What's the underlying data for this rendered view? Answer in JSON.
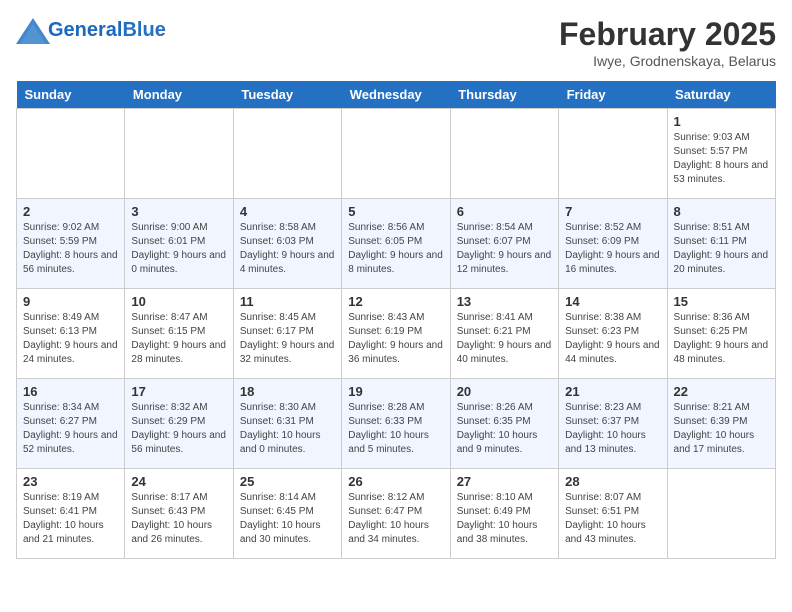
{
  "header": {
    "logo_line1": "General",
    "logo_line2": "Blue",
    "month_title": "February 2025",
    "location": "Iwye, Grodnenskaya, Belarus"
  },
  "days_of_week": [
    "Sunday",
    "Monday",
    "Tuesday",
    "Wednesday",
    "Thursday",
    "Friday",
    "Saturday"
  ],
  "weeks": [
    [
      {
        "day": "",
        "info": ""
      },
      {
        "day": "",
        "info": ""
      },
      {
        "day": "",
        "info": ""
      },
      {
        "day": "",
        "info": ""
      },
      {
        "day": "",
        "info": ""
      },
      {
        "day": "",
        "info": ""
      },
      {
        "day": "1",
        "info": "Sunrise: 9:03 AM\nSunset: 5:57 PM\nDaylight: 8 hours and 53 minutes."
      }
    ],
    [
      {
        "day": "2",
        "info": "Sunrise: 9:02 AM\nSunset: 5:59 PM\nDaylight: 8 hours and 56 minutes."
      },
      {
        "day": "3",
        "info": "Sunrise: 9:00 AM\nSunset: 6:01 PM\nDaylight: 9 hours and 0 minutes."
      },
      {
        "day": "4",
        "info": "Sunrise: 8:58 AM\nSunset: 6:03 PM\nDaylight: 9 hours and 4 minutes."
      },
      {
        "day": "5",
        "info": "Sunrise: 8:56 AM\nSunset: 6:05 PM\nDaylight: 9 hours and 8 minutes."
      },
      {
        "day": "6",
        "info": "Sunrise: 8:54 AM\nSunset: 6:07 PM\nDaylight: 9 hours and 12 minutes."
      },
      {
        "day": "7",
        "info": "Sunrise: 8:52 AM\nSunset: 6:09 PM\nDaylight: 9 hours and 16 minutes."
      },
      {
        "day": "8",
        "info": "Sunrise: 8:51 AM\nSunset: 6:11 PM\nDaylight: 9 hours and 20 minutes."
      }
    ],
    [
      {
        "day": "9",
        "info": "Sunrise: 8:49 AM\nSunset: 6:13 PM\nDaylight: 9 hours and 24 minutes."
      },
      {
        "day": "10",
        "info": "Sunrise: 8:47 AM\nSunset: 6:15 PM\nDaylight: 9 hours and 28 minutes."
      },
      {
        "day": "11",
        "info": "Sunrise: 8:45 AM\nSunset: 6:17 PM\nDaylight: 9 hours and 32 minutes."
      },
      {
        "day": "12",
        "info": "Sunrise: 8:43 AM\nSunset: 6:19 PM\nDaylight: 9 hours and 36 minutes."
      },
      {
        "day": "13",
        "info": "Sunrise: 8:41 AM\nSunset: 6:21 PM\nDaylight: 9 hours and 40 minutes."
      },
      {
        "day": "14",
        "info": "Sunrise: 8:38 AM\nSunset: 6:23 PM\nDaylight: 9 hours and 44 minutes."
      },
      {
        "day": "15",
        "info": "Sunrise: 8:36 AM\nSunset: 6:25 PM\nDaylight: 9 hours and 48 minutes."
      }
    ],
    [
      {
        "day": "16",
        "info": "Sunrise: 8:34 AM\nSunset: 6:27 PM\nDaylight: 9 hours and 52 minutes."
      },
      {
        "day": "17",
        "info": "Sunrise: 8:32 AM\nSunset: 6:29 PM\nDaylight: 9 hours and 56 minutes."
      },
      {
        "day": "18",
        "info": "Sunrise: 8:30 AM\nSunset: 6:31 PM\nDaylight: 10 hours and 0 minutes."
      },
      {
        "day": "19",
        "info": "Sunrise: 8:28 AM\nSunset: 6:33 PM\nDaylight: 10 hours and 5 minutes."
      },
      {
        "day": "20",
        "info": "Sunrise: 8:26 AM\nSunset: 6:35 PM\nDaylight: 10 hours and 9 minutes."
      },
      {
        "day": "21",
        "info": "Sunrise: 8:23 AM\nSunset: 6:37 PM\nDaylight: 10 hours and 13 minutes."
      },
      {
        "day": "22",
        "info": "Sunrise: 8:21 AM\nSunset: 6:39 PM\nDaylight: 10 hours and 17 minutes."
      }
    ],
    [
      {
        "day": "23",
        "info": "Sunrise: 8:19 AM\nSunset: 6:41 PM\nDaylight: 10 hours and 21 minutes."
      },
      {
        "day": "24",
        "info": "Sunrise: 8:17 AM\nSunset: 6:43 PM\nDaylight: 10 hours and 26 minutes."
      },
      {
        "day": "25",
        "info": "Sunrise: 8:14 AM\nSunset: 6:45 PM\nDaylight: 10 hours and 30 minutes."
      },
      {
        "day": "26",
        "info": "Sunrise: 8:12 AM\nSunset: 6:47 PM\nDaylight: 10 hours and 34 minutes."
      },
      {
        "day": "27",
        "info": "Sunrise: 8:10 AM\nSunset: 6:49 PM\nDaylight: 10 hours and 38 minutes."
      },
      {
        "day": "28",
        "info": "Sunrise: 8:07 AM\nSunset: 6:51 PM\nDaylight: 10 hours and 43 minutes."
      },
      {
        "day": "",
        "info": ""
      }
    ]
  ]
}
